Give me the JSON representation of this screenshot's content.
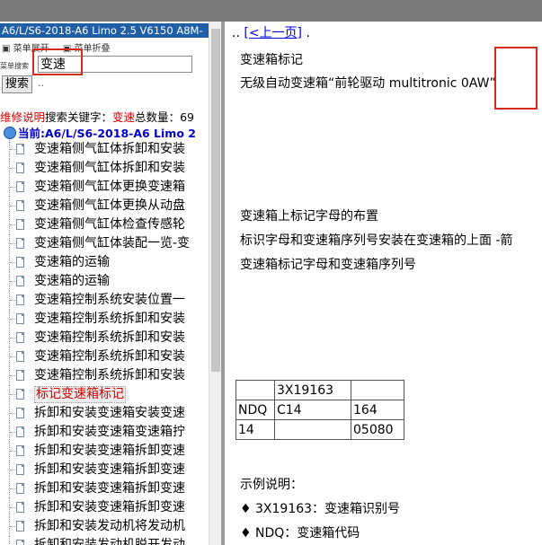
{
  "left": {
    "title": "A6/L/S6-2018-A6 Limo 2.5 V6150 A8M-",
    "menu": {
      "expand": "菜单展开",
      "collapse": "菜单折叠"
    },
    "search": {
      "label": "菜单搜索",
      "value": "变速",
      "button": "搜索",
      "dots": ".."
    },
    "summary": {
      "prefix": "维修说明",
      "middle": "搜索关键字：",
      "keyword": "变速",
      "count_label": "总数量：",
      "count": "69"
    },
    "current": "当前:A6/L/S6-2018-A6 Limo 2",
    "tree": [
      "变速箱侧气缸体拆卸和安装",
      "变速箱侧气缸体拆卸和安装",
      "变速箱侧气缸体更换变速箱",
      "变速箱侧气缸体更换从动盘",
      "变速箱侧气缸体检查传感轮",
      "变速箱侧气缸体装配一览-变",
      "变速箱的运输",
      "变速箱的运输",
      "变速箱控制系统安装位置一",
      "变速箱控制系统拆卸和安装",
      "变速箱控制系统拆卸和安装",
      "变速箱控制系统拆卸和安装",
      "变速箱控制系统拆卸和安装",
      "标记变速箱标记",
      "拆卸和安装变速箱安装变速",
      "拆卸和安装变速箱变速箱拧",
      "拆卸和安装变速箱拆卸变速",
      "拆卸和安装变速箱拆卸变速",
      "拆卸和安装变速箱拆卸变速",
      "拆卸和安装变速箱拆卸变速",
      "拆卸和安装发动机将发动机",
      "拆卸和安装发动机脱开发动"
    ],
    "selected_index": 13
  },
  "right": {
    "prev_prefix": "..",
    "prev_link": "[<上一页]",
    "prev_suffix": ".",
    "line1": "变速箱标记",
    "line2": "无级自动变速箱“前轮驱动 multitronic 0AW”",
    "line3": "变速箱上标记字母的布置",
    "line4": "标识字母和变速箱序列号安装在变速箱的上面 -箭",
    "line5": "变速箱标记字母和变速箱序列号",
    "table": [
      [
        "",
        "3X19163",
        ""
      ],
      [
        "NDQ",
        "C14",
        "164"
      ],
      [
        "14",
        "",
        "05080"
      ]
    ],
    "example_title": "示例说明：",
    "bullets": [
      "♦  3X19163：变速箱识别号",
      "♦  NDQ：变速箱代码"
    ]
  }
}
